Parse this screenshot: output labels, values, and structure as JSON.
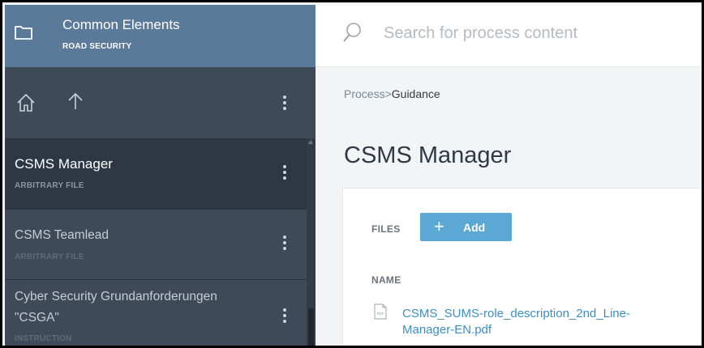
{
  "workspace": {
    "title": "Common Elements",
    "subtitle": "ROAD SECURITY",
    "icon": "folder-icon"
  },
  "navigation": {
    "home_icon": "home-icon",
    "up_icon": "arrow-up-icon",
    "menu_icon": "more-vertical-icon"
  },
  "sidebar": {
    "items": [
      {
        "label": "CSMS Manager",
        "type": "ARBITRARY FILE",
        "active": true
      },
      {
        "label": "CSMS Teamlead",
        "type": "ARBITRARY FILE",
        "active": false
      },
      {
        "label_line1": "Cyber Security Grundanforderungen",
        "label_line2": "\"CSGA\"",
        "type": "INSTRUCTION",
        "active": false
      }
    ]
  },
  "search": {
    "placeholder": "Search for process content"
  },
  "breadcrumb": {
    "parent": "Process",
    "separator": ">",
    "current": "Guidance"
  },
  "page": {
    "title": "CSMS Manager"
  },
  "files_panel": {
    "label": "FILES",
    "add_label": "Add",
    "add_icon": "plus-icon",
    "column_header": "NAME",
    "files": [
      {
        "name": "CSMS_SUMS-role_description_2nd_Line-Manager-EN.pdf",
        "icon": "pdf-file-icon",
        "icon_text": "PDF"
      }
    ]
  },
  "colors": {
    "sidebar_bg": "#3e4a57",
    "workspace_bg": "#5b7a99",
    "active_item_bg": "#2e3844",
    "accent_button": "#5aa8d3",
    "link": "#3b8fc7"
  }
}
